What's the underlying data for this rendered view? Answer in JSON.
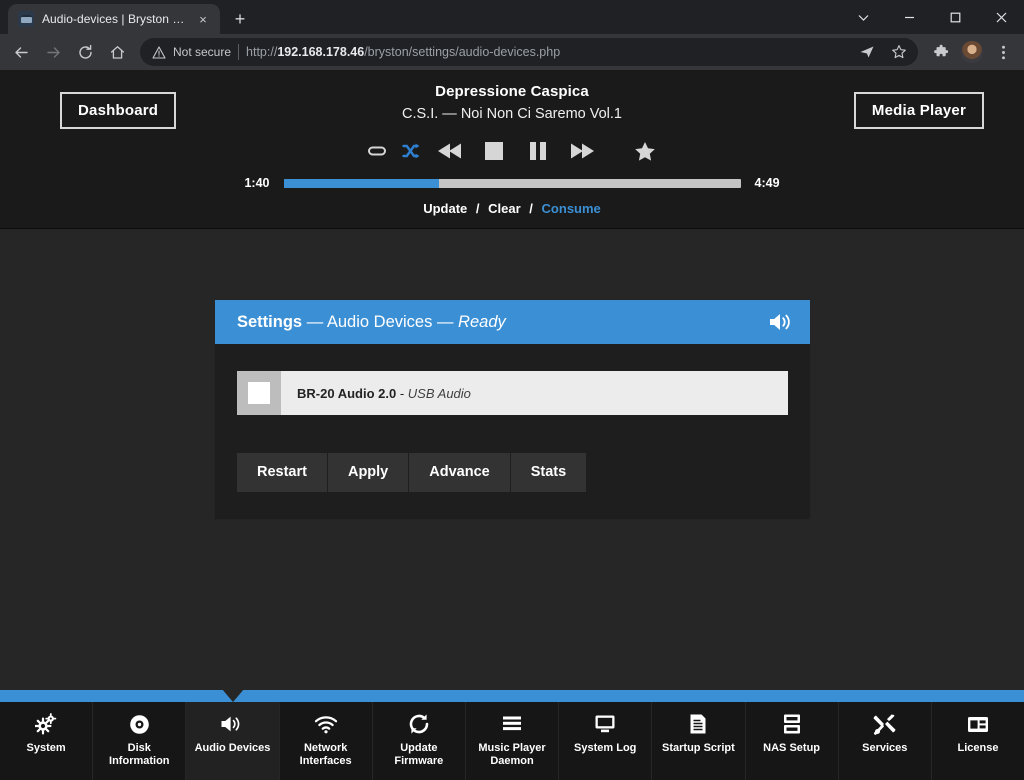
{
  "browser": {
    "tab": {
      "title": "Audio-devices | Bryston BDP",
      "favicon": "monitor-icon",
      "close": "×"
    },
    "newtab_label": "+",
    "window_controls": [
      "chevron-down-icon",
      "minimize-icon",
      "maximize-icon",
      "close-icon"
    ],
    "toolbar": {
      "back": "back-icon",
      "forward": "forward-icon",
      "reload": "reload-icon",
      "home": "home-icon",
      "security_label": "Not secure",
      "url_scheme": "http://",
      "url_host": "192.168.178.46",
      "url_path": "/bryston/settings/audio-devices.php",
      "share": "share-icon",
      "bookmark": "star-icon",
      "extensions": "puzzle-icon",
      "profile": "avatar",
      "menu": "three-dot-menu-icon"
    }
  },
  "player": {
    "dashboard_button": "Dashboard",
    "media_player_button": "Media Player",
    "track_title": "Depressione Caspica",
    "track_subtitle": "C.S.I. — Noi Non Ci Saremo Vol.1",
    "controls": [
      {
        "name": "repeat-icon",
        "state": "off"
      },
      {
        "name": "shuffle-icon",
        "state": "on"
      },
      {
        "name": "previous-icon",
        "state": "off"
      },
      {
        "name": "stop-icon",
        "state": "off"
      },
      {
        "name": "pause-icon",
        "state": "off"
      },
      {
        "name": "next-icon",
        "state": "off"
      },
      {
        "name": "favorite-star-icon",
        "state": "off"
      }
    ],
    "elapsed": "1:40",
    "duration": "4:49",
    "progress_percent": 34,
    "links": {
      "update": "Update",
      "clear": "Clear",
      "consume": "Consume",
      "separator": "/"
    }
  },
  "card": {
    "header": {
      "section": "Settings",
      "dash1": "—",
      "page": "Audio Devices",
      "dash2": "—",
      "status": "Ready",
      "icon": "speaker-icon"
    },
    "devices": [
      {
        "checked": false,
        "name": "BR-20 Audio 2.0",
        "separator": "-",
        "type": "USB Audio"
      }
    ],
    "buttons": [
      "Restart",
      "Apply",
      "Advance",
      "Stats"
    ]
  },
  "bottom_nav": {
    "accent_color": "#3b8fd4",
    "active_index": 2,
    "items": [
      {
        "label": "System",
        "icon": "gears-icon"
      },
      {
        "label": "Disk\nInformation",
        "icon": "disc-icon"
      },
      {
        "label": "Audio Devices",
        "icon": "speaker-icon"
      },
      {
        "label": "Network\nInterfaces",
        "icon": "wifi-icon"
      },
      {
        "label": "Update\nFirmware",
        "icon": "refresh-icon"
      },
      {
        "label": "Music Player\nDaemon",
        "icon": "list-icon"
      },
      {
        "label": "System Log",
        "icon": "monitor-icon"
      },
      {
        "label": "Startup Script",
        "icon": "document-icon"
      },
      {
        "label": "NAS Setup",
        "icon": "server-icon"
      },
      {
        "label": "Services",
        "icon": "tools-icon"
      },
      {
        "label": "License",
        "icon": "badge-icon"
      }
    ]
  }
}
